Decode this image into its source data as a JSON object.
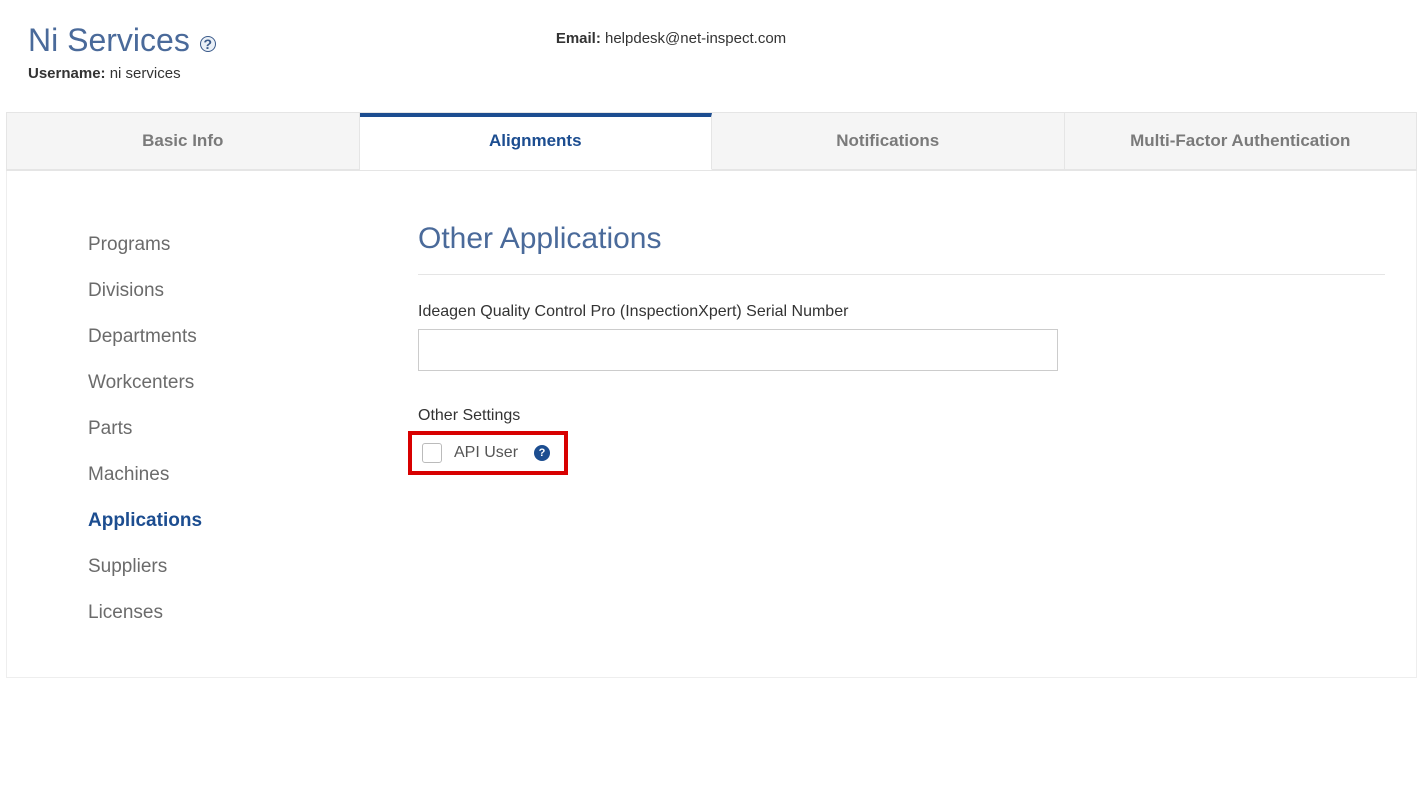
{
  "header": {
    "title": "Ni Services",
    "help_icon": "?",
    "username_label": "Username:",
    "username_value": "ni services",
    "email_label": "Email:",
    "email_value": "helpdesk@net-inspect.com"
  },
  "tabs": [
    {
      "label": "Basic Info",
      "active": false
    },
    {
      "label": "Alignments",
      "active": true
    },
    {
      "label": "Notifications",
      "active": false
    },
    {
      "label": "Multi-Factor Authentication",
      "active": false
    }
  ],
  "sidebar": {
    "items": [
      {
        "label": "Programs",
        "active": false
      },
      {
        "label": "Divisions",
        "active": false
      },
      {
        "label": "Departments",
        "active": false
      },
      {
        "label": "Workcenters",
        "active": false
      },
      {
        "label": "Parts",
        "active": false
      },
      {
        "label": "Machines",
        "active": false
      },
      {
        "label": "Applications",
        "active": true
      },
      {
        "label": "Suppliers",
        "active": false
      },
      {
        "label": "Licenses",
        "active": false
      }
    ]
  },
  "main": {
    "section_title": "Other Applications",
    "serial_label": "Ideagen Quality Control Pro (InspectionXpert) Serial Number",
    "serial_value": "",
    "other_settings_heading": "Other Settings",
    "api_user_label": "API User",
    "api_user_checked": false,
    "help_icon": "?"
  }
}
